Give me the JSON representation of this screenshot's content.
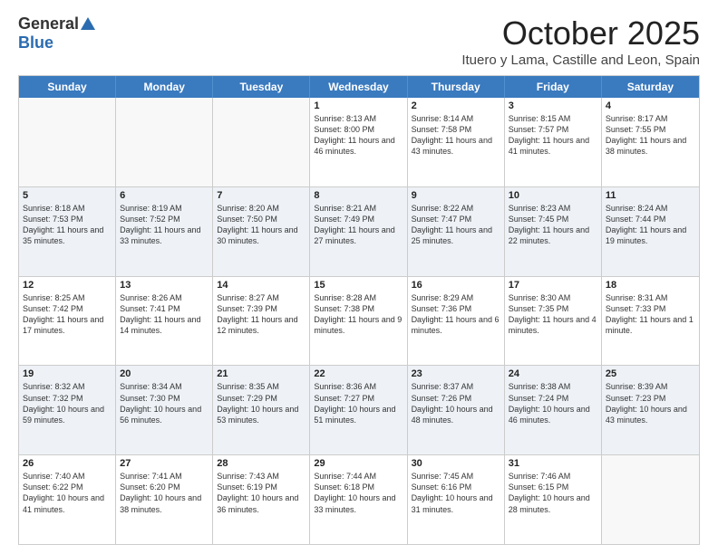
{
  "logo": {
    "general": "General",
    "blue": "Blue"
  },
  "header": {
    "month": "October 2025",
    "location": "Ituero y Lama, Castille and Leon, Spain"
  },
  "weekdays": [
    "Sunday",
    "Monday",
    "Tuesday",
    "Wednesday",
    "Thursday",
    "Friday",
    "Saturday"
  ],
  "rows": [
    {
      "alt": false,
      "cells": [
        {
          "day": "",
          "text": ""
        },
        {
          "day": "",
          "text": ""
        },
        {
          "day": "",
          "text": ""
        },
        {
          "day": "1",
          "text": "Sunrise: 8:13 AM\nSunset: 8:00 PM\nDaylight: 11 hours and 46 minutes."
        },
        {
          "day": "2",
          "text": "Sunrise: 8:14 AM\nSunset: 7:58 PM\nDaylight: 11 hours and 43 minutes."
        },
        {
          "day": "3",
          "text": "Sunrise: 8:15 AM\nSunset: 7:57 PM\nDaylight: 11 hours and 41 minutes."
        },
        {
          "day": "4",
          "text": "Sunrise: 8:17 AM\nSunset: 7:55 PM\nDaylight: 11 hours and 38 minutes."
        }
      ]
    },
    {
      "alt": true,
      "cells": [
        {
          "day": "5",
          "text": "Sunrise: 8:18 AM\nSunset: 7:53 PM\nDaylight: 11 hours and 35 minutes."
        },
        {
          "day": "6",
          "text": "Sunrise: 8:19 AM\nSunset: 7:52 PM\nDaylight: 11 hours and 33 minutes."
        },
        {
          "day": "7",
          "text": "Sunrise: 8:20 AM\nSunset: 7:50 PM\nDaylight: 11 hours and 30 minutes."
        },
        {
          "day": "8",
          "text": "Sunrise: 8:21 AM\nSunset: 7:49 PM\nDaylight: 11 hours and 27 minutes."
        },
        {
          "day": "9",
          "text": "Sunrise: 8:22 AM\nSunset: 7:47 PM\nDaylight: 11 hours and 25 minutes."
        },
        {
          "day": "10",
          "text": "Sunrise: 8:23 AM\nSunset: 7:45 PM\nDaylight: 11 hours and 22 minutes."
        },
        {
          "day": "11",
          "text": "Sunrise: 8:24 AM\nSunset: 7:44 PM\nDaylight: 11 hours and 19 minutes."
        }
      ]
    },
    {
      "alt": false,
      "cells": [
        {
          "day": "12",
          "text": "Sunrise: 8:25 AM\nSunset: 7:42 PM\nDaylight: 11 hours and 17 minutes."
        },
        {
          "day": "13",
          "text": "Sunrise: 8:26 AM\nSunset: 7:41 PM\nDaylight: 11 hours and 14 minutes."
        },
        {
          "day": "14",
          "text": "Sunrise: 8:27 AM\nSunset: 7:39 PM\nDaylight: 11 hours and 12 minutes."
        },
        {
          "day": "15",
          "text": "Sunrise: 8:28 AM\nSunset: 7:38 PM\nDaylight: 11 hours and 9 minutes."
        },
        {
          "day": "16",
          "text": "Sunrise: 8:29 AM\nSunset: 7:36 PM\nDaylight: 11 hours and 6 minutes."
        },
        {
          "day": "17",
          "text": "Sunrise: 8:30 AM\nSunset: 7:35 PM\nDaylight: 11 hours and 4 minutes."
        },
        {
          "day": "18",
          "text": "Sunrise: 8:31 AM\nSunset: 7:33 PM\nDaylight: 11 hours and 1 minute."
        }
      ]
    },
    {
      "alt": true,
      "cells": [
        {
          "day": "19",
          "text": "Sunrise: 8:32 AM\nSunset: 7:32 PM\nDaylight: 10 hours and 59 minutes."
        },
        {
          "day": "20",
          "text": "Sunrise: 8:34 AM\nSunset: 7:30 PM\nDaylight: 10 hours and 56 minutes."
        },
        {
          "day": "21",
          "text": "Sunrise: 8:35 AM\nSunset: 7:29 PM\nDaylight: 10 hours and 53 minutes."
        },
        {
          "day": "22",
          "text": "Sunrise: 8:36 AM\nSunset: 7:27 PM\nDaylight: 10 hours and 51 minutes."
        },
        {
          "day": "23",
          "text": "Sunrise: 8:37 AM\nSunset: 7:26 PM\nDaylight: 10 hours and 48 minutes."
        },
        {
          "day": "24",
          "text": "Sunrise: 8:38 AM\nSunset: 7:24 PM\nDaylight: 10 hours and 46 minutes."
        },
        {
          "day": "25",
          "text": "Sunrise: 8:39 AM\nSunset: 7:23 PM\nDaylight: 10 hours and 43 minutes."
        }
      ]
    },
    {
      "alt": false,
      "cells": [
        {
          "day": "26",
          "text": "Sunrise: 7:40 AM\nSunset: 6:22 PM\nDaylight: 10 hours and 41 minutes."
        },
        {
          "day": "27",
          "text": "Sunrise: 7:41 AM\nSunset: 6:20 PM\nDaylight: 10 hours and 38 minutes."
        },
        {
          "day": "28",
          "text": "Sunrise: 7:43 AM\nSunset: 6:19 PM\nDaylight: 10 hours and 36 minutes."
        },
        {
          "day": "29",
          "text": "Sunrise: 7:44 AM\nSunset: 6:18 PM\nDaylight: 10 hours and 33 minutes."
        },
        {
          "day": "30",
          "text": "Sunrise: 7:45 AM\nSunset: 6:16 PM\nDaylight: 10 hours and 31 minutes."
        },
        {
          "day": "31",
          "text": "Sunrise: 7:46 AM\nSunset: 6:15 PM\nDaylight: 10 hours and 28 minutes."
        },
        {
          "day": "",
          "text": ""
        }
      ]
    }
  ]
}
